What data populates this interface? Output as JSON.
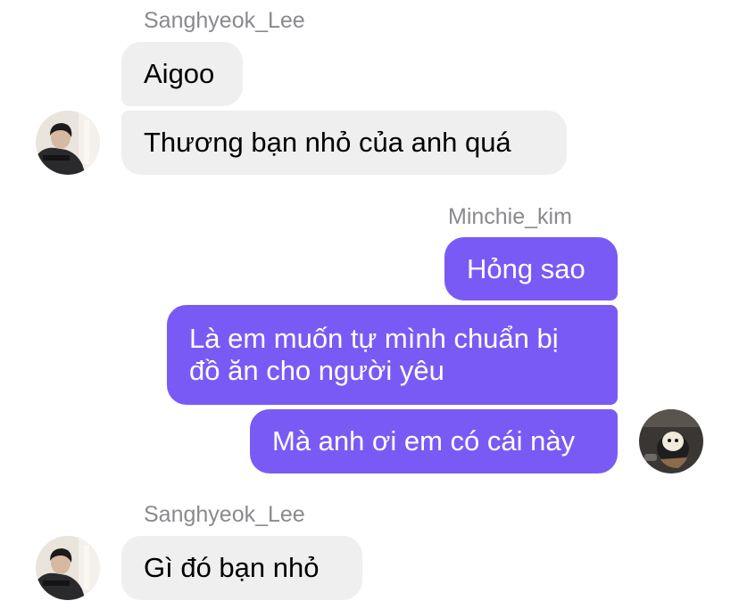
{
  "colors": {
    "incoming_bubble": "#efefef",
    "outgoing_bubble": "#7a5af5",
    "sender_name": "#8a8a8e"
  },
  "conversation": {
    "group1": {
      "sender": "Sanghyeok_Lee",
      "messages": [
        "Aigoo",
        "Thương bạn nhỏ của anh quá"
      ],
      "avatar_icon": "user-avatar-icon"
    },
    "group2": {
      "sender": "Minchie_kim",
      "messages": [
        "Hỏng sao",
        "Là em muốn tự mình chuẩn bị đồ ăn cho người yêu",
        "Mà anh ơi em có cái này"
      ],
      "avatar_icon": "user-avatar-icon"
    },
    "group3": {
      "sender": "Sanghyeok_Lee",
      "messages": [
        "Gì đó bạn nhỏ"
      ],
      "avatar_icon": "user-avatar-icon"
    }
  }
}
